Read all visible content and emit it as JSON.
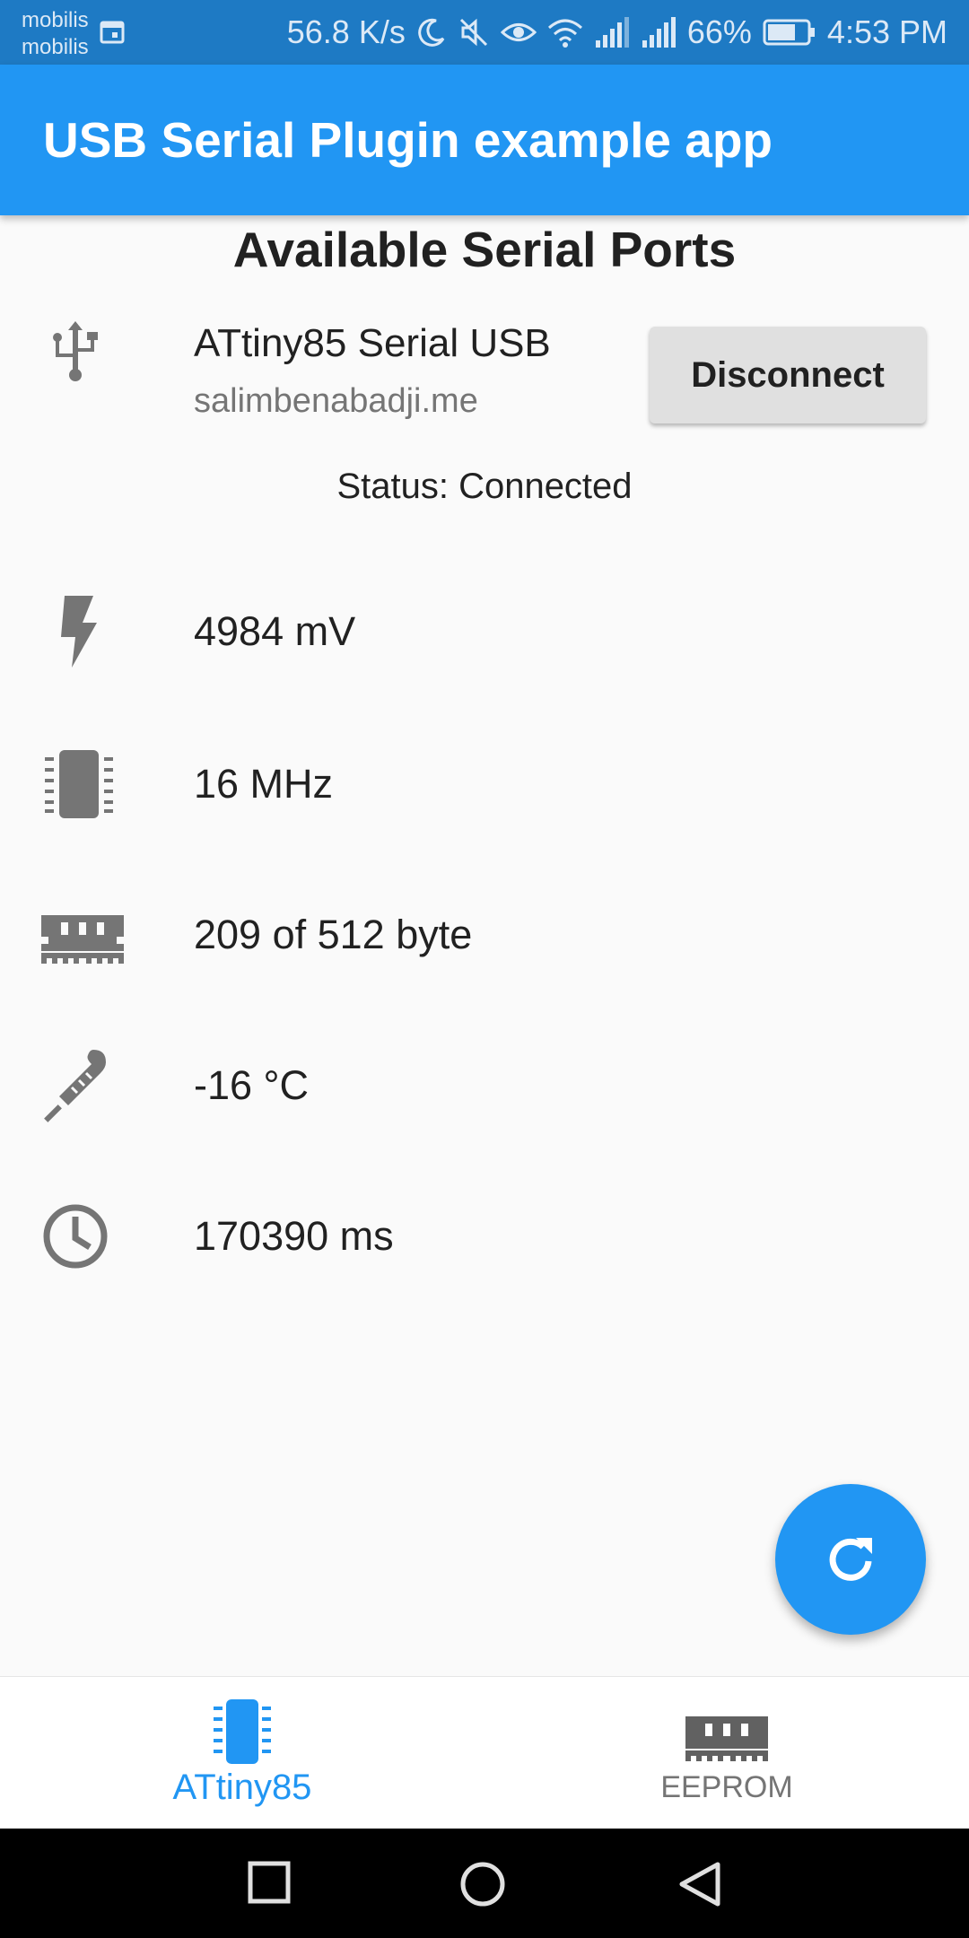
{
  "status_bar": {
    "carrier1": "mobilis",
    "carrier2": "mobilis",
    "net_speed": "56.8 K/s",
    "battery": "66%",
    "time": "4:53 PM"
  },
  "app_bar": {
    "title": "USB Serial Plugin example app"
  },
  "main": {
    "heading": "Available Serial Ports",
    "port": {
      "name": "ATtiny85 Serial USB",
      "manufacturer": "salimbenabadji.me",
      "button_label": "Disconnect"
    },
    "status": "Status: Connected",
    "info": [
      {
        "icon": "flash-icon",
        "value": "4984 mV"
      },
      {
        "icon": "chip-icon",
        "value": "16 MHz"
      },
      {
        "icon": "memory-icon",
        "value": "209 of 512 byte"
      },
      {
        "icon": "thermometer-icon",
        "value": "-16 °C"
      },
      {
        "icon": "clock-icon",
        "value": "170390 ms"
      }
    ]
  },
  "fab": {
    "icon": "refresh-icon"
  },
  "bottom_nav": {
    "items": [
      {
        "label": "ATtiny85",
        "icon": "chip-icon",
        "active": true
      },
      {
        "label": "EEPROM",
        "icon": "memory-icon",
        "active": false
      }
    ]
  },
  "colors": {
    "primary": "#2196f3",
    "status_bar": "#1e7ac4",
    "icon_grey": "#757575"
  }
}
